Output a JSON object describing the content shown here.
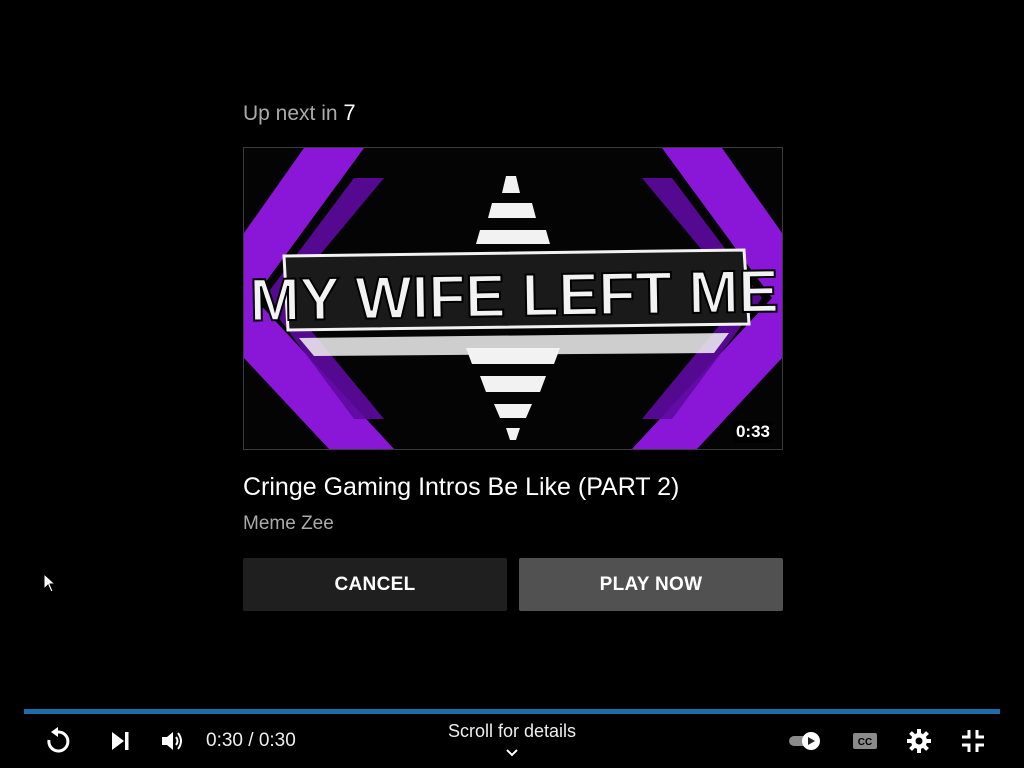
{
  "up_next": {
    "prefix": "Up next in",
    "countdown": "7",
    "thumbnail": {
      "text": "MY WIFE LEFT ME",
      "duration": "0:33",
      "accent_color": "#8a16d8"
    },
    "title": "Cringe Gaming Intros Be Like (PART 2)",
    "channel": "Meme Zee",
    "cancel_label": "CANCEL",
    "play_now_label": "PLAY NOW"
  },
  "player": {
    "progress_fraction": 1.0,
    "progress_color": "#1a6fa8",
    "current_time": "0:30",
    "duration": "0:30",
    "scroll_hint": "Scroll for details",
    "icons": {
      "replay": "replay-icon",
      "next": "skip-next-icon",
      "volume": "volume-icon",
      "autoplay": "autoplay-toggle-icon",
      "captions": "captions-icon",
      "settings": "gear-icon",
      "exit_fullscreen": "exit-fullscreen-icon",
      "chevron": "chevron-down-icon"
    }
  }
}
